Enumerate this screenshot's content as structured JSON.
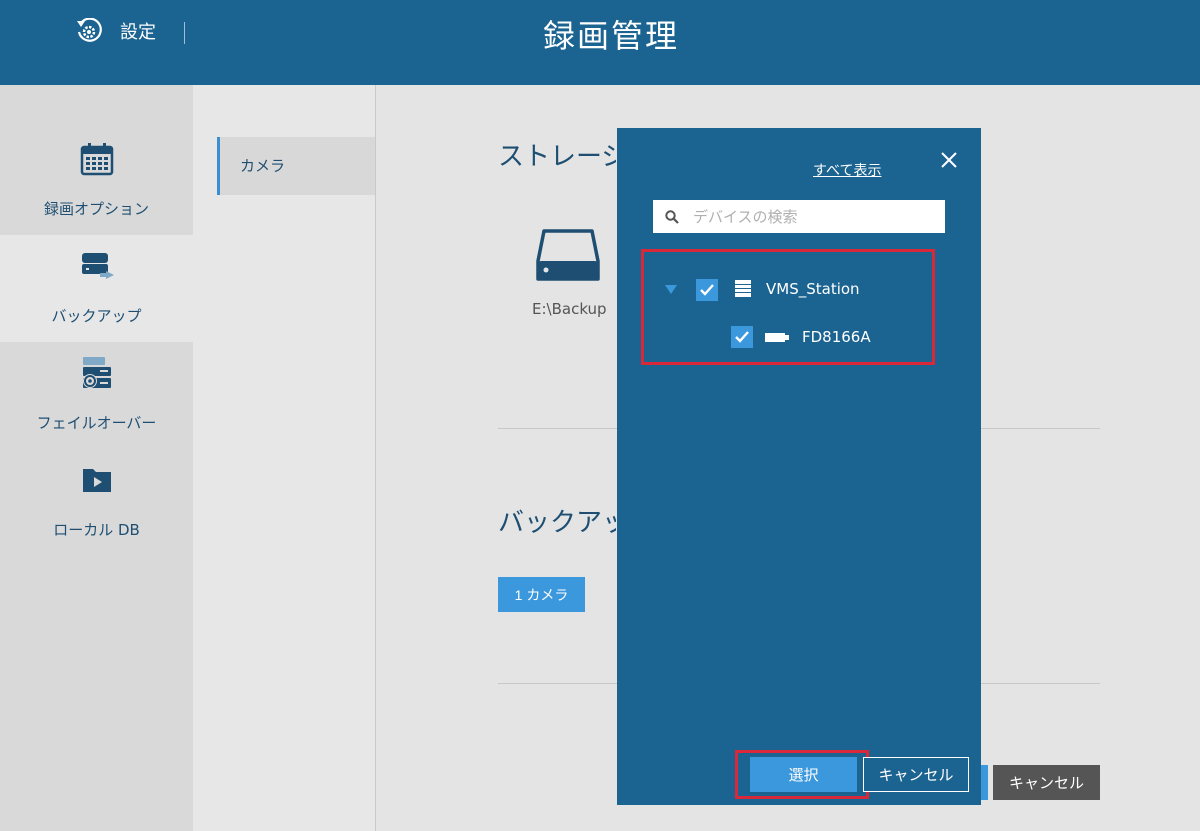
{
  "header": {
    "settings_label": "設定",
    "title": "録画管理"
  },
  "leftnav": {
    "items": [
      {
        "label": "録画オプション",
        "icon": "calendar-icon"
      },
      {
        "label": "バックアップ",
        "icon": "backup-drive-icon"
      },
      {
        "label": "フェイルオーバー",
        "icon": "failover-icon"
      },
      {
        "label": "ローカル DB",
        "icon": "folder-video-icon"
      }
    ]
  },
  "subnav": {
    "items": [
      {
        "label": "カメラ"
      }
    ]
  },
  "main": {
    "storage_heading": "ストレージ",
    "drive_label": "E:\\Backup",
    "backup_heading": "バックアップ",
    "camera_count_button": "1 カメラ",
    "cancel_label": "キャンセル"
  },
  "modal": {
    "show_all_label": "すべて表示",
    "search_placeholder": "デバイスの検索",
    "search_value": "",
    "tree": {
      "root": {
        "label": "VMS_Station",
        "checked": true,
        "expanded": true
      },
      "children": [
        {
          "label": "FD8166A",
          "checked": true
        }
      ]
    },
    "select_label": "選択",
    "cancel_label": "キャンセル"
  },
  "colors": {
    "header_bg": "#1b6390",
    "accent": "#3b98dc",
    "highlight": "#d8283a"
  }
}
